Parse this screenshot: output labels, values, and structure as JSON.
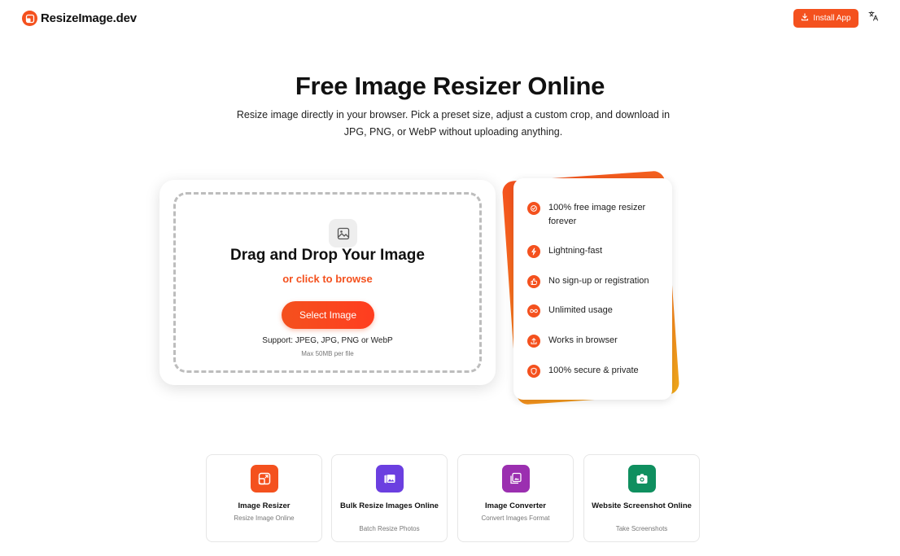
{
  "header": {
    "logo_text": "ResizeImage.dev",
    "install_label": "Install App",
    "brand_color": "#f4511e"
  },
  "hero": {
    "title": "Free Image Resizer Online",
    "subtitle": "Resize image directly in your browser. Pick a preset size, adjust a custom crop, and download in JPG, PNG, or WebP without uploading anything."
  },
  "upload": {
    "title": "Drag and Drop Your Image",
    "browse_label": "or click to browse",
    "select_button": "Select Image",
    "support_text": "Support: JPEG, JPG, PNG or WebP",
    "max_size_text": "Max 50MB per file"
  },
  "features": [
    {
      "icon": "check-circle-icon",
      "label": "100% free image resizer forever"
    },
    {
      "icon": "lightning-icon",
      "label": "Lightning-fast"
    },
    {
      "icon": "thumbs-up-icon",
      "label": "No sign-up or registration"
    },
    {
      "icon": "infinity-icon",
      "label": "Unlimited usage"
    },
    {
      "icon": "upload-icon",
      "label": "Works in browser"
    },
    {
      "icon": "shield-icon",
      "label": "100% secure & private"
    }
  ],
  "tools": [
    {
      "name": "Image Resizer",
      "desc": "Resize Image Online",
      "icon": "image-resize-icon",
      "color": "#f4511e"
    },
    {
      "name": "Bulk Resize Images Online",
      "desc": "Batch Resize Photos",
      "icon": "image-gallery-icon",
      "color": "#6b3fe0"
    },
    {
      "name": "Image Converter",
      "desc": "Convert Images Format",
      "icon": "image-convert-icon",
      "color": "#9b2fb0"
    },
    {
      "name": "Website Screenshot Online",
      "desc": "Take Screenshots",
      "icon": "camera-icon",
      "color": "#0f8f5f"
    }
  ]
}
